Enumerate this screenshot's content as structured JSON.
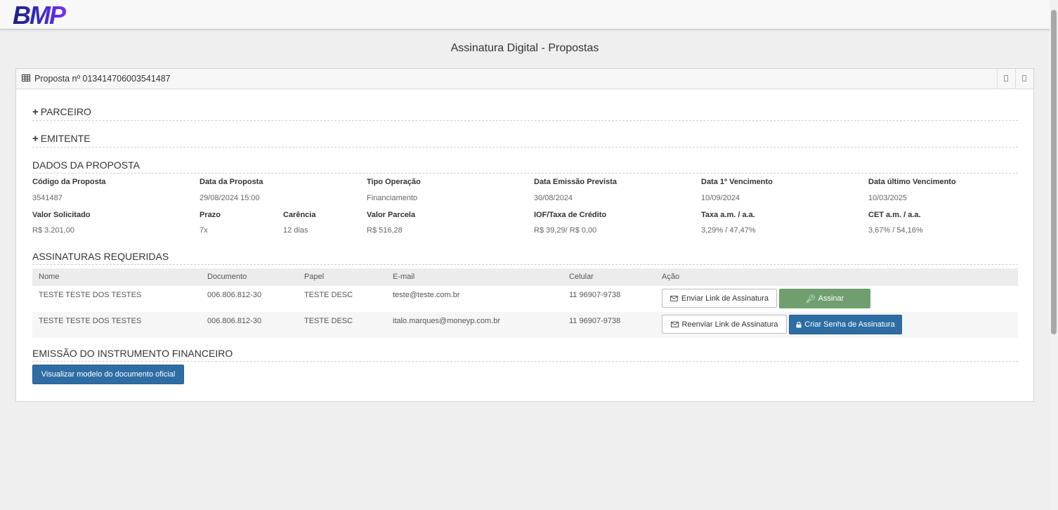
{
  "brand": {
    "logo_text": "BMP"
  },
  "page": {
    "title": "Assinatura Digital - Propostas"
  },
  "panel": {
    "title": "Proposta nº 013414706003541487",
    "sections": {
      "parceiro": "PARCEIRO",
      "emitente": "EMITENTE",
      "dados": "DADOS DA PROPOSTA",
      "assinaturas": "ASSINATURAS REQUERIDAS",
      "emissao": "EMISSÃO DO INSTRUMENTO FINANCEIRO"
    },
    "dados": {
      "codigo_label": "Código da Proposta",
      "codigo": "3541487",
      "data_label": "Data da Proposta",
      "data": "29/08/2024 15:00",
      "tipo_label": "Tipo Operação",
      "tipo": "Financiamento",
      "emissao_label": "Data Emissão Prevista",
      "emissao": "30/08/2024",
      "venc1_label": "Data 1º Vencimento",
      "venc1": "10/09/2024",
      "vencu_label": "Data último Vencimento",
      "vencu": "10/03/2025",
      "valor_label": "Valor Solicitado",
      "valor": "R$ 3.201,00",
      "prazo_label": "Prazo",
      "prazo": "7x",
      "carencia_label": "Carência",
      "carencia": "12 dias",
      "parcela_label": "Valor Parcela",
      "parcela": "R$ 516,28",
      "iof_label": "IOF/Taxa de Crédito",
      "iof": "R$ 39,29/ R$ 0,00",
      "taxa_label": "Taxa a.m. / a.a.",
      "taxa": "3,29% / 47,47%",
      "cet_label": "CET a.m. / a.a.",
      "cet": "3,67% / 54,16%"
    },
    "assinaturas": {
      "headers": [
        "Nome",
        "Documento",
        "Papel",
        "E-mail",
        "Celular",
        "Ação"
      ],
      "rows": [
        {
          "nome": "TESTE TESTE DOS TESTES",
          "documento": "006.806.812-30",
          "papel": "TESTE DESC",
          "email": "teste@teste.com.br",
          "celular": "11 96907-9738",
          "action1": "Enviar Link de Assinatura",
          "action2": "Assinar"
        },
        {
          "nome": "TESTE TESTE DOS TESTES",
          "documento": "006.806.812-30",
          "papel": "TESTE DESC",
          "email": "italo.marques@moneyp.com.br",
          "celular": "11 96907-9738",
          "action1": "Reenviar Link de Assinatura",
          "action2": "Criar Senha de Assinatura"
        }
      ]
    },
    "emissao_button": "Visualizar modelo do documento oficial"
  },
  "colors": {
    "logo_dark": "#1a237e",
    "logo_purple": "#7b2ff7",
    "btn_green": "#6f9f6f",
    "btn_blue": "#2e6da4"
  }
}
